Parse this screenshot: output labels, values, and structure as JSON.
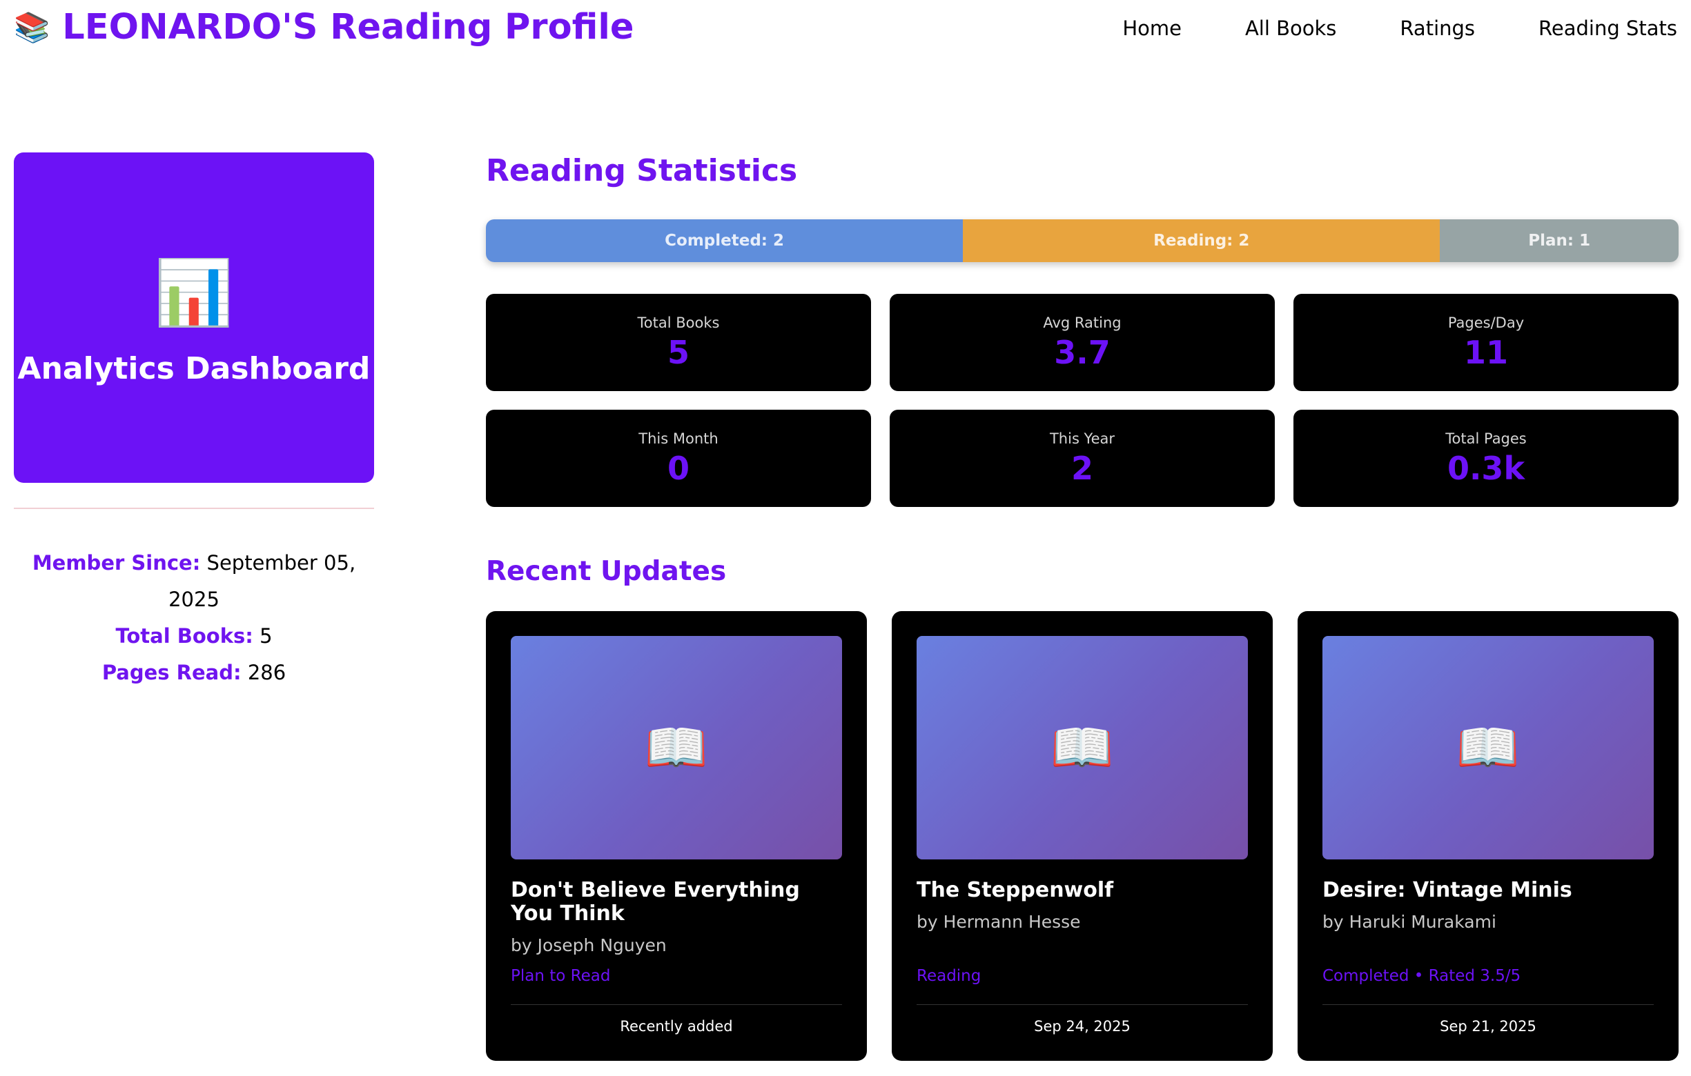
{
  "header": {
    "icon": "books-icon",
    "title": "LEONARDO'S Reading Profile",
    "nav": [
      "Home",
      "All Books",
      "Ratings",
      "Reading Stats"
    ]
  },
  "sidebar": {
    "icon": "bar-chart-icon",
    "card_title": "Analytics Dashboard",
    "member_since_label": "Member Since:",
    "member_since": "September 05, 2025",
    "total_books_label": "Total Books:",
    "total_books": "5",
    "pages_read_label": "Pages Read:",
    "pages_read": "286"
  },
  "stats": {
    "title": "Reading Statistics",
    "progress": [
      {
        "label": "Completed: 2",
        "count": 2,
        "color": "#5f8edc"
      },
      {
        "label": "Reading: 2",
        "count": 2,
        "color": "#e8a43e"
      },
      {
        "label": "Plan: 1",
        "count": 1,
        "color": "#97a4a5"
      }
    ],
    "cards": [
      {
        "label": "Total Books",
        "value": "5"
      },
      {
        "label": "Avg Rating",
        "value": "3.7"
      },
      {
        "label": "Pages/Day",
        "value": "11"
      },
      {
        "label": "This Month",
        "value": "0"
      },
      {
        "label": "This Year",
        "value": "2"
      },
      {
        "label": "Total Pages",
        "value": "0.3k"
      }
    ]
  },
  "recent": {
    "title": "Recent Updates",
    "books": [
      {
        "title": "Don't Believe Everything You Think",
        "author": "by Joseph Nguyen",
        "status": "Plan to Read",
        "date": "Recently added"
      },
      {
        "title": "The Steppenwolf",
        "author": "by Hermann Hesse",
        "status": "Reading",
        "date": "Sep 24, 2025"
      },
      {
        "title": "Desire: Vintage Minis",
        "author": "by Haruki Murakami",
        "status": "Completed • Rated 3.5/5",
        "date": "Sep 21, 2025"
      }
    ]
  },
  "colors": {
    "accent": "#6c12f6",
    "card_bg": "#000000"
  }
}
